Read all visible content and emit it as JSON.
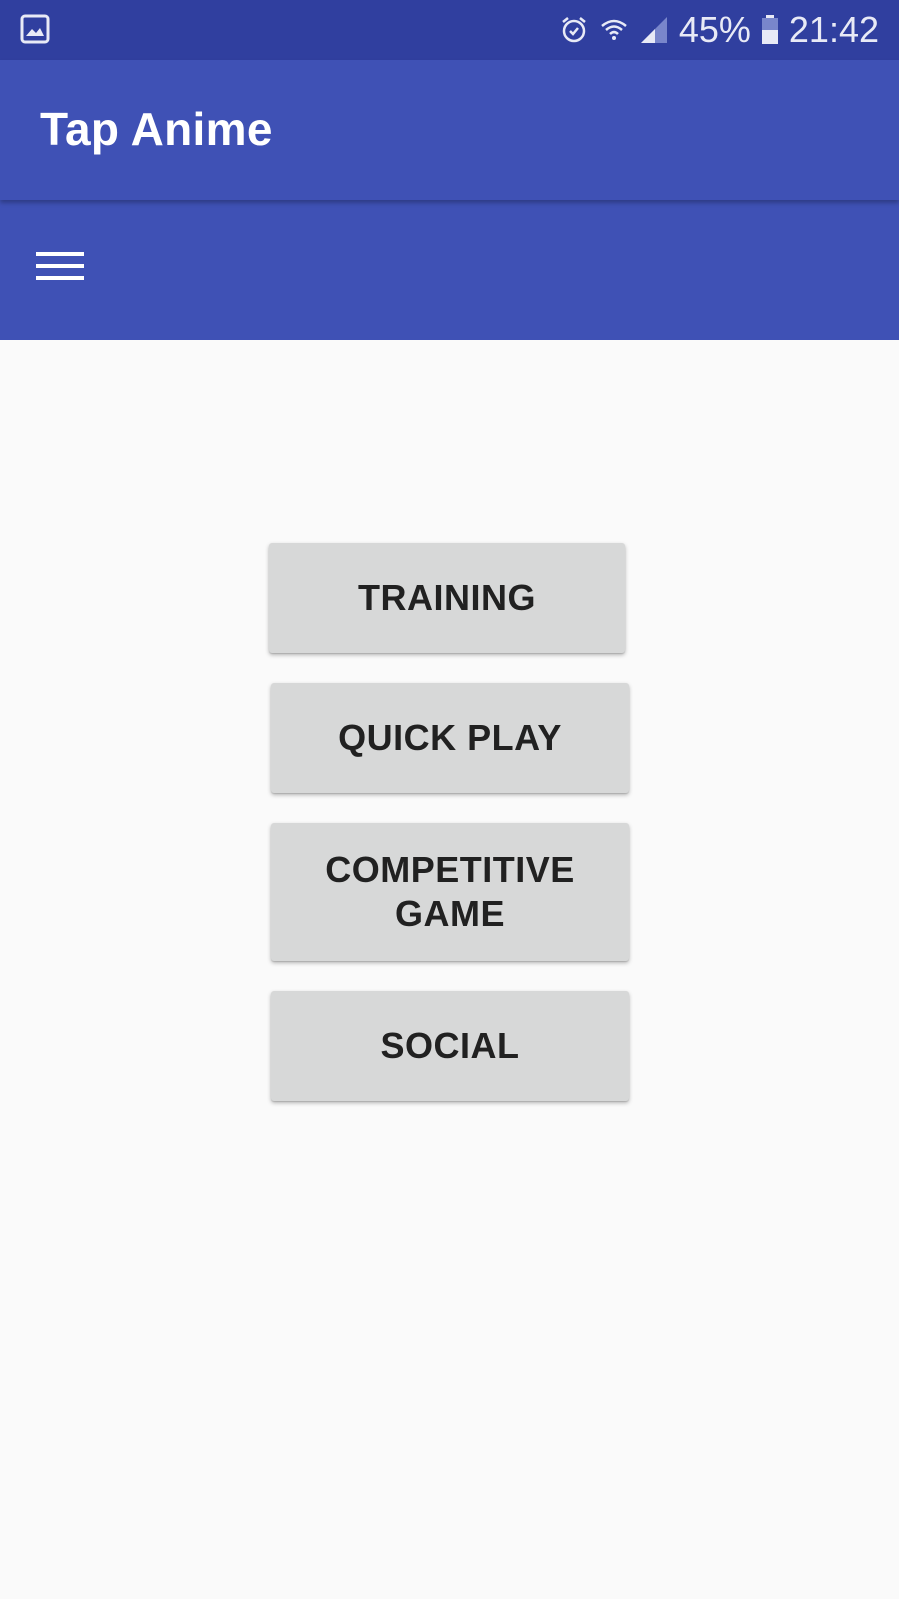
{
  "status_bar": {
    "notification_icon": "image-icon",
    "alarm_icon": "alarm-icon",
    "wifi_icon": "wifi-icon",
    "signal_icon": "signal-icon",
    "battery_icon": "battery-icon",
    "battery": "45%",
    "time": "21:42"
  },
  "app_bar": {
    "title": "Tap Anime",
    "menu_icon": "hamburger-menu-icon"
  },
  "menu": {
    "training_label": "TRAINING",
    "quick_play_label": "QUICK PLAY",
    "competitive_line1": "COMPETITIVE",
    "competitive_line2": "GAME",
    "social_label": "SOCIAL"
  },
  "colors": {
    "status_bar": "#303f9f",
    "app_bar": "#3f51b5",
    "background": "#fafafa",
    "button": "#d7d8d8",
    "button_text": "#212121"
  }
}
